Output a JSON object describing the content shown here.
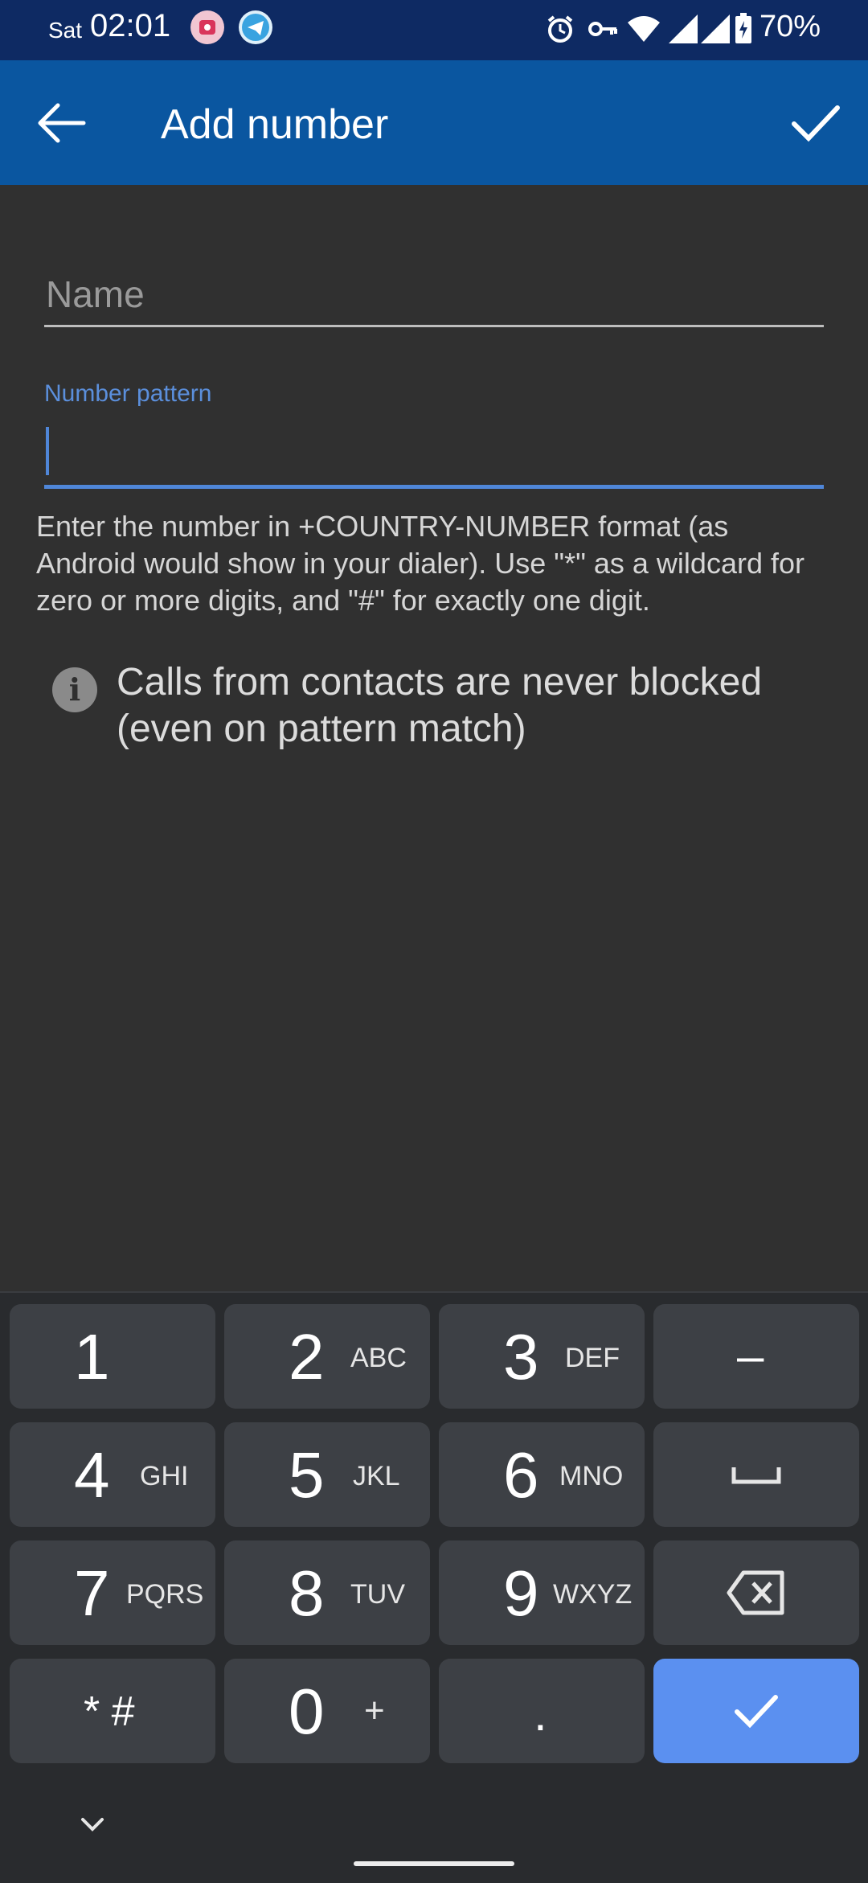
{
  "status_bar": {
    "day": "Sat",
    "time": "02:01",
    "battery_percent": "70%",
    "icons": [
      "app-pink-icon",
      "telegram-icon",
      "alarm-icon",
      "vpn-key-icon",
      "wifi-icon",
      "signal-icon",
      "signal-icon",
      "battery-charging-icon"
    ]
  },
  "app_bar": {
    "title": "Add number",
    "back_icon": "arrow-left-icon",
    "confirm_icon": "check-icon"
  },
  "form": {
    "name_placeholder": "Name",
    "name_value": "",
    "pattern_label": "Number pattern",
    "pattern_value": "",
    "help_text": "Enter the number in +COUNTRY-NUMBER format (as Android would show in your dialer). Use \"*\" as a wildcard for zero or more digits, and \"#\" for exactly one digit.",
    "info_text": "Calls from contacts are never blocked (even on pattern match)"
  },
  "keyboard": {
    "keys": [
      {
        "digit": "1",
        "letters": ""
      },
      {
        "digit": "2",
        "letters": "ABC"
      },
      {
        "digit": "3",
        "letters": "DEF"
      },
      {
        "symbol": "–"
      },
      {
        "digit": "4",
        "letters": "GHI"
      },
      {
        "digit": "5",
        "letters": "JKL"
      },
      {
        "digit": "6",
        "letters": "MNO"
      },
      {
        "icon": "space-icon"
      },
      {
        "digit": "7",
        "letters": "PQRS"
      },
      {
        "digit": "8",
        "letters": "TUV"
      },
      {
        "digit": "9",
        "letters": "WXYZ"
      },
      {
        "icon": "backspace-icon"
      },
      {
        "symbol": "* #"
      },
      {
        "digit": "0",
        "letters": "+"
      },
      {
        "symbol": "."
      },
      {
        "icon": "check-icon"
      }
    ],
    "accent": "#5b90f0"
  },
  "colors": {
    "status_bar": "#0e2a63",
    "app_bar": "#0a56a0",
    "background": "#303030",
    "focus": "#4f86d8"
  }
}
